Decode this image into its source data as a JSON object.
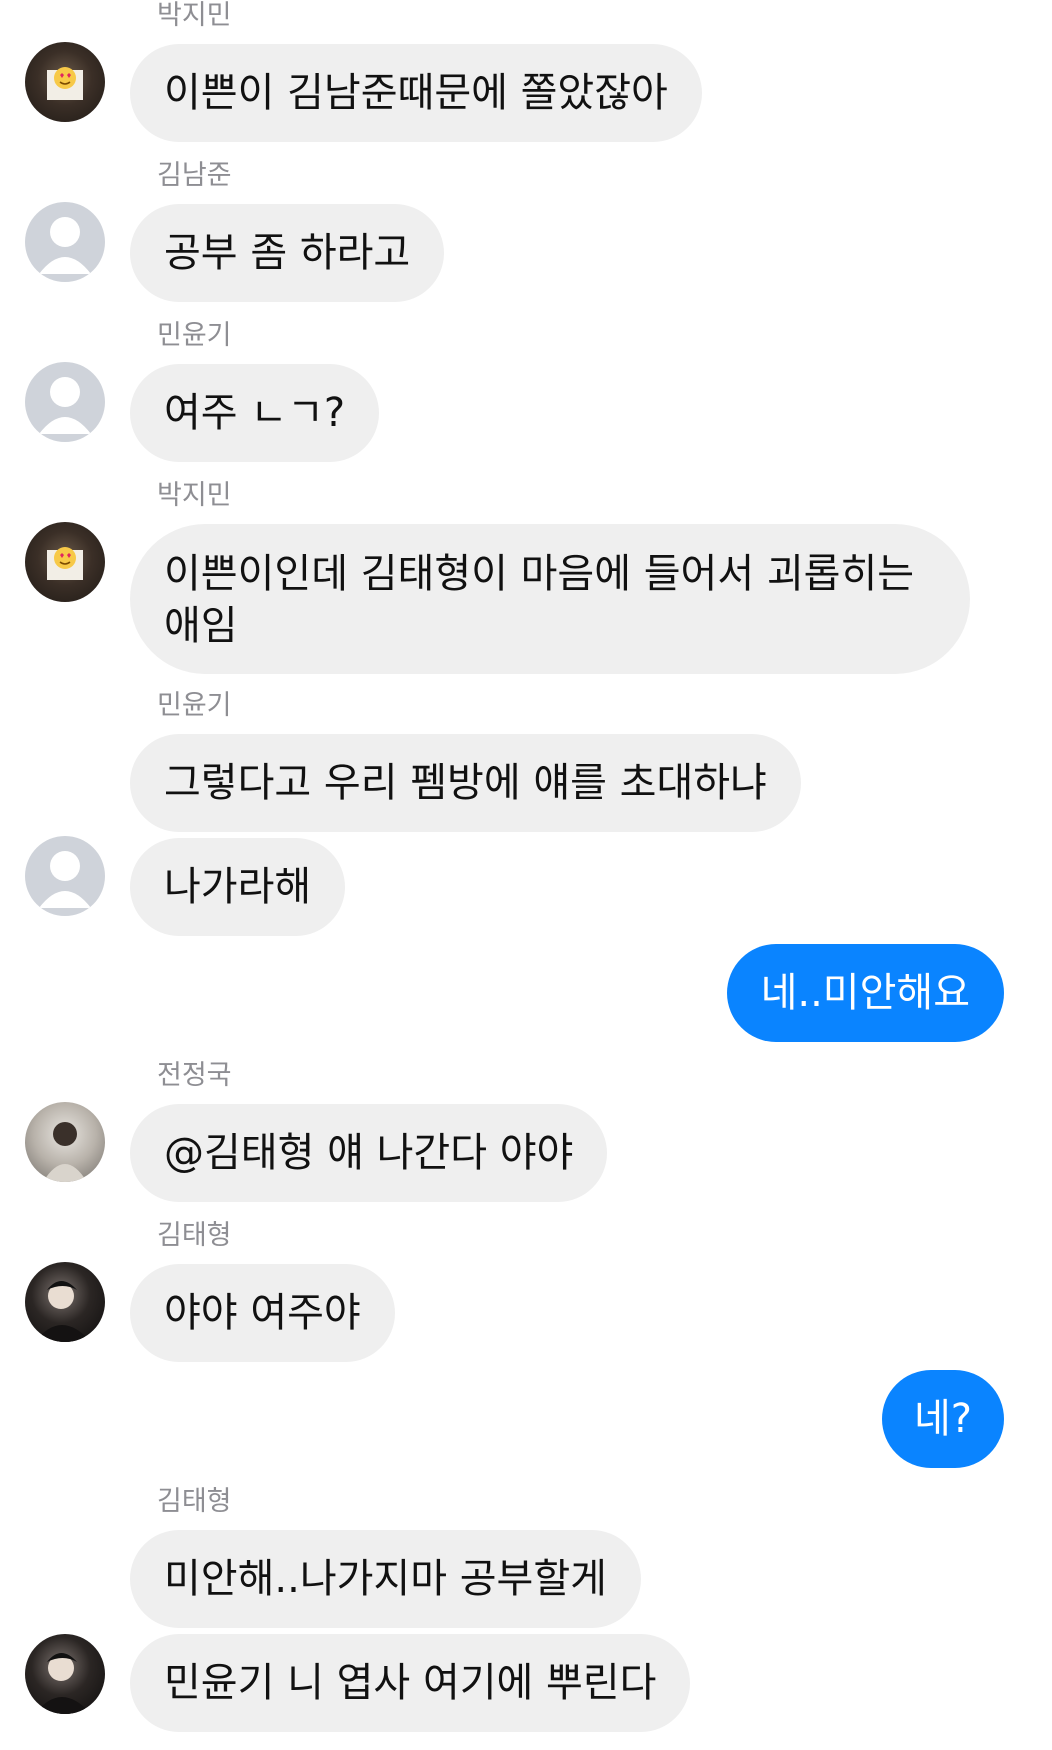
{
  "messages": [
    {
      "sender": "박지민",
      "text": "이쁜이 김남준때문에 쫄았잖아"
    },
    {
      "sender": "김남준",
      "text": "공부 좀 하라고"
    },
    {
      "sender": "민윤기",
      "text": "여주 ㄴㄱ?"
    },
    {
      "sender": "박지민",
      "text": "이쁜이인데 김태형이 마음에 들어서 괴롭히는 애임"
    },
    {
      "sender": "민윤기",
      "text": "그렇다고 우리 펨방에 얘를 초대하냐"
    },
    {
      "text": "나가라해"
    },
    {
      "text": "네..미안해요",
      "from_me": true
    },
    {
      "sender": "전정국",
      "text": "@김태형 얘 나간다 야야"
    },
    {
      "sender": "김태형",
      "text": "야야 여주야"
    },
    {
      "text": "네?",
      "from_me": true
    },
    {
      "sender": "김태형",
      "text": "미안해..나가지마 공부할게"
    },
    {
      "text": "민윤기 니 엽사 여기에 뿌린다"
    }
  ],
  "colors": {
    "received_bubble": "#efefef",
    "sent_bubble": "#0a84ff",
    "sender_name": "#8e8e93"
  }
}
